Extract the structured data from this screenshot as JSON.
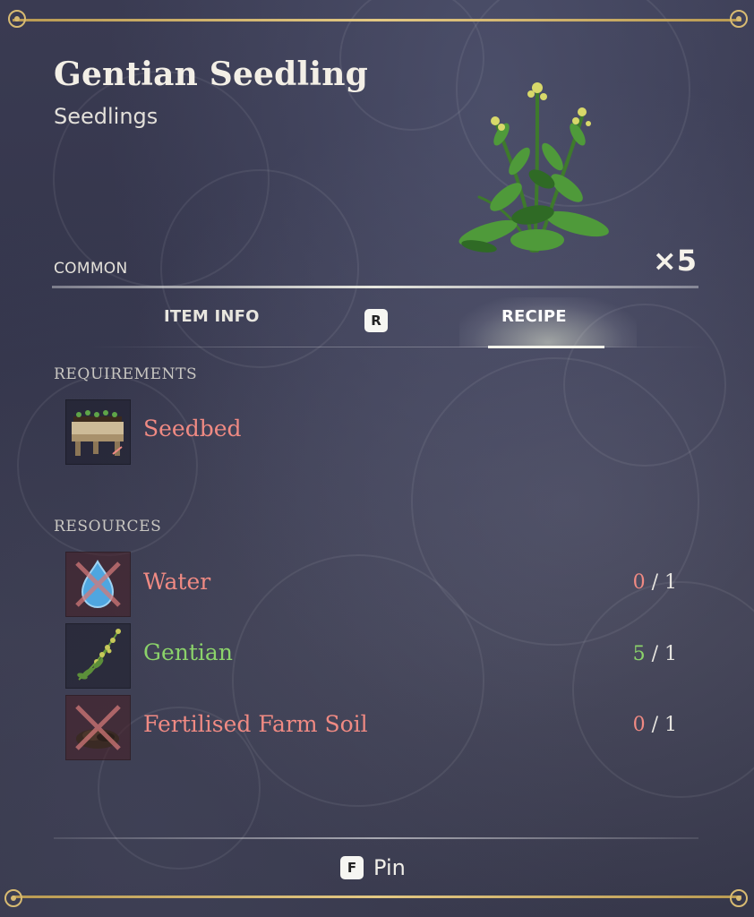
{
  "item": {
    "name": "Gentian Seedling",
    "category": "Seedlings",
    "rarity": "COMMON",
    "quantity": "×5"
  },
  "tabs": {
    "item_info": "ITEM INFO",
    "switch_key": "R",
    "recipe": "RECIPE",
    "active": "RECIPE"
  },
  "requirements": {
    "label": "REQUIREMENTS",
    "items": [
      {
        "name": "Seedbed",
        "icon": "seedbed-icon",
        "status": "missing"
      }
    ]
  },
  "resources": {
    "label": "RESOURCES",
    "items": [
      {
        "name": "Water",
        "icon": "water-drop-icon",
        "have": "0",
        "sep": "/",
        "need": "1",
        "status": "missing"
      },
      {
        "name": "Gentian",
        "icon": "gentian-icon",
        "have": "5",
        "sep": "/",
        "need": "1",
        "status": "ok"
      },
      {
        "name": "Fertilised Farm Soil",
        "icon": "farm-soil-icon",
        "have": "0",
        "sep": "/",
        "need": "1",
        "status": "missing"
      }
    ]
  },
  "footer": {
    "pin_key": "F",
    "pin_label": "Pin"
  },
  "colors": {
    "missing": "#f08a83",
    "ok": "#8bd36a",
    "frame_gold": "#d8bb72",
    "panel_bg": "#34354b"
  }
}
